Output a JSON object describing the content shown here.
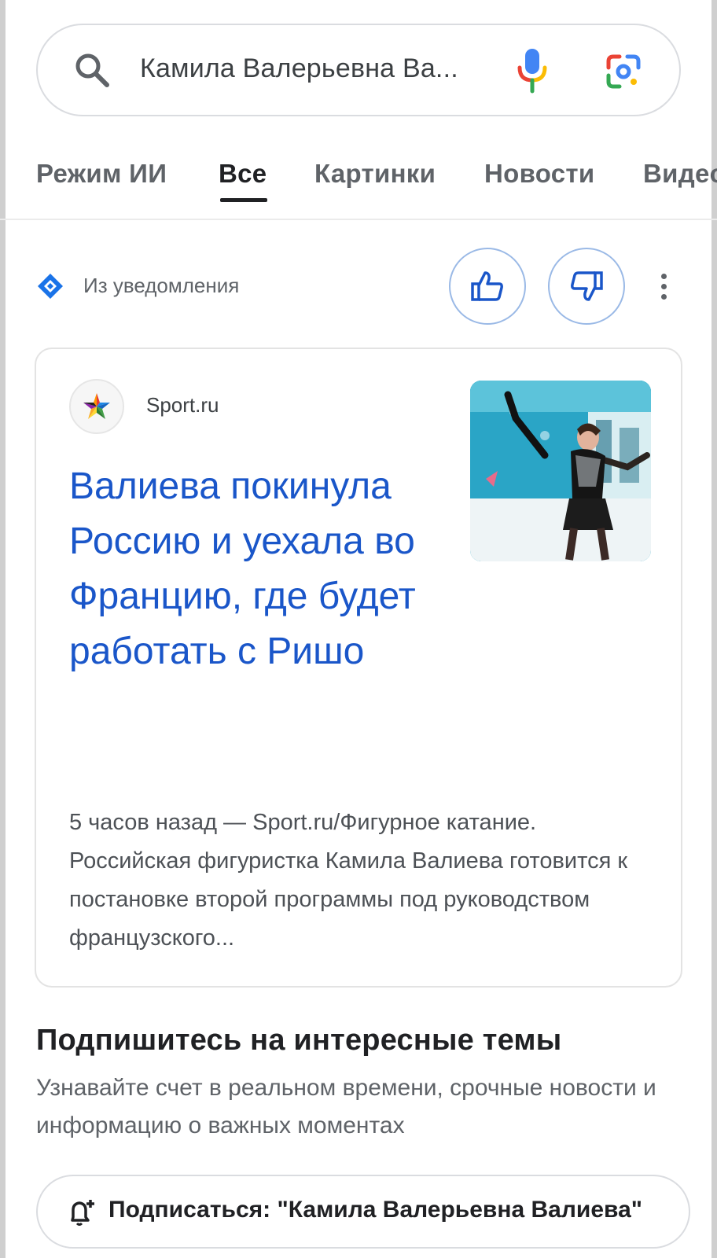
{
  "search": {
    "query": "Камила Валерьевна Ва..."
  },
  "tabs": [
    {
      "label": "Режим ИИ"
    },
    {
      "label": "Все"
    },
    {
      "label": "Картинки"
    },
    {
      "label": "Новости"
    },
    {
      "label": "Видео"
    }
  ],
  "notification": {
    "label": "Из уведомления"
  },
  "card": {
    "source": "Sport.ru",
    "headline": "Валиева покинула Россию и уехала во Францию, где будет работать с Ришо",
    "snippet": "5 часов назад — Sport.ru/Фигурное катание. Российская фигуристка Камила Валиева готовится к постановке второй программы под руководством французского..."
  },
  "topics": {
    "title": "Подпишитесь на интересные темы",
    "subtitle": "Узнавайте счет в реальном времени, срочные новости и информацию о важных моментах",
    "subscribe_label": "Подписаться: \"Камила Валерьевна Валиева\""
  },
  "colors": {
    "link": "#1a56c9",
    "accent_blue": "#1a73e8",
    "google_red": "#ea4335",
    "google_yellow": "#fbbc04",
    "google_green": "#34a853"
  }
}
